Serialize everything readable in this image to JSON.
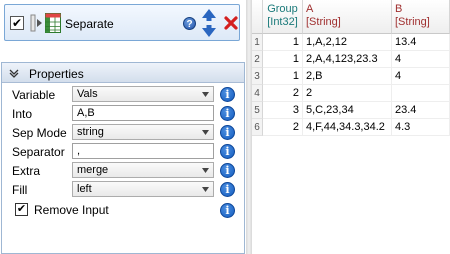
{
  "step": {
    "label": "Separate",
    "checked": true,
    "help_icon": "question-icon",
    "move_icon": "up-down-arrows-icon",
    "delete_icon": "red-x-icon"
  },
  "properties": {
    "title": "Properties",
    "fields": [
      {
        "label": "Variable",
        "value": "Vals",
        "type": "select"
      },
      {
        "label": "Into",
        "value": "A,B",
        "type": "text"
      },
      {
        "label": "Sep Mode",
        "value": "string",
        "type": "select"
      },
      {
        "label": "Separator",
        "value": ",",
        "type": "text"
      },
      {
        "label": "Extra",
        "value": "merge",
        "type": "select"
      },
      {
        "label": "Fill",
        "value": "left",
        "type": "select"
      }
    ],
    "remove_input": {
      "label": "Remove Input",
      "checked": true
    }
  },
  "table": {
    "columns": [
      {
        "name": "Group",
        "type": "[Int32]"
      },
      {
        "name": "A",
        "type": "[String]"
      },
      {
        "name": "B",
        "type": "[String]"
      }
    ],
    "rows": [
      {
        "n": "1",
        "group": "1",
        "a": "1,A,2,12",
        "b": "13.4"
      },
      {
        "n": "2",
        "group": "1",
        "a": "2,A,4,123,23.3",
        "b": "4"
      },
      {
        "n": "3",
        "group": "1",
        "a": "2,B",
        "b": "4"
      },
      {
        "n": "4",
        "group": "2",
        "a": "2",
        "b": ""
      },
      {
        "n": "5",
        "group": "3",
        "a": "5,C,23,34",
        "b": "23.4"
      },
      {
        "n": "6",
        "group": "2",
        "a": "4,F,44,34.3,34.2",
        "b": "4.3"
      }
    ]
  }
}
